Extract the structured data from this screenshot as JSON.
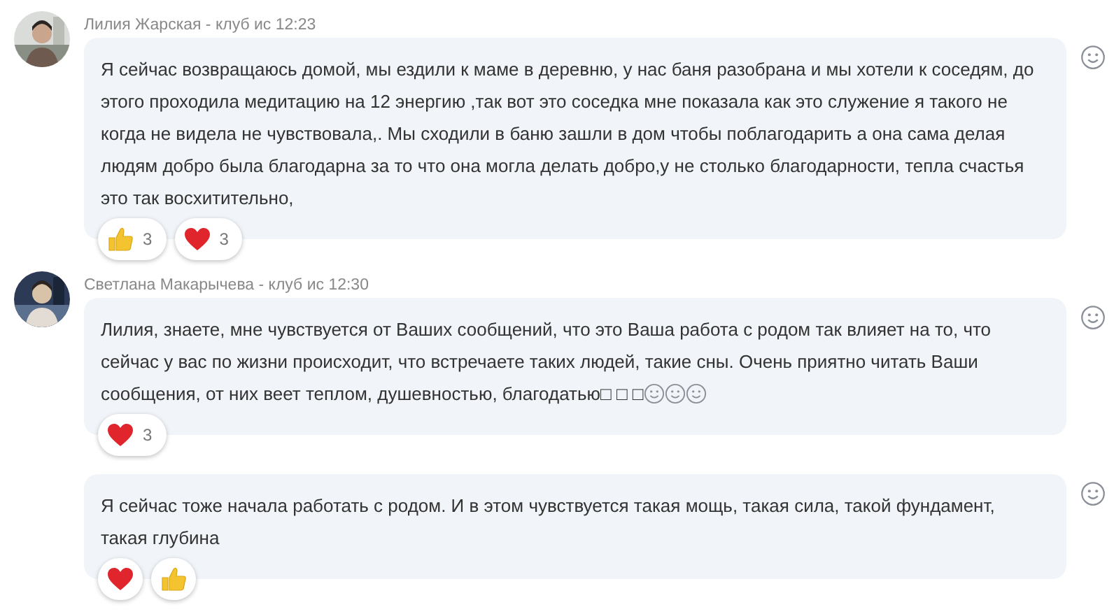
{
  "threads": [
    {
      "header": "Лилия Жарская - клуб ис 12:23",
      "avatar": {
        "kind": "picture"
      },
      "messages": [
        {
          "text": "Я сейчас возвращаюсь домой, мы ездили к маме в деревню, у нас баня разобрана и мы хотели к соседям, до этого проходила медитацию на 12 энергию ,так вот это соседка мне показала как это служение я такого не когда не видела не чувствовала,. Мы сходили в баню зашли в дом чтобы поблагодарить а она сама делая людям добро была благодарна за то что она могла делать добро,у не столько благодарности, тепла счастья это так восхитительно,",
          "reactions": [
            {
              "kind": "like",
              "count": "3"
            },
            {
              "kind": "heart",
              "count": "3"
            }
          ]
        }
      ]
    },
    {
      "header": "Светлана Макарычева - клуб ис 12:30",
      "avatar": {
        "kind": "picture"
      },
      "messages": [
        {
          "text": "Лилия, знаете, мне чувствуется от Ваших сообщений, что это Ваша работа с родом так влияет на то, что сейчас у вас по жизни происходит, что встречаете таких людей, такие сны. Очень приятно читать Ваши сообщения, от них веет теплом, душевностью, благодатью□ □ □",
          "emoji": [
            {
              "kind": "smiley"
            },
            {
              "kind": "smiley"
            },
            {
              "kind": "smiley"
            }
          ],
          "reactions": [
            {
              "kind": "heart",
              "count": "3"
            }
          ]
        },
        {
          "text": "Я сейчас тоже начала работать с родом. И в этом чувствуется такая мощь, такая сила, такой фундамент, такая глубина",
          "reactions": [
            {
              "kind": "heart"
            },
            {
              "kind": "like"
            }
          ]
        }
      ]
    }
  ]
}
